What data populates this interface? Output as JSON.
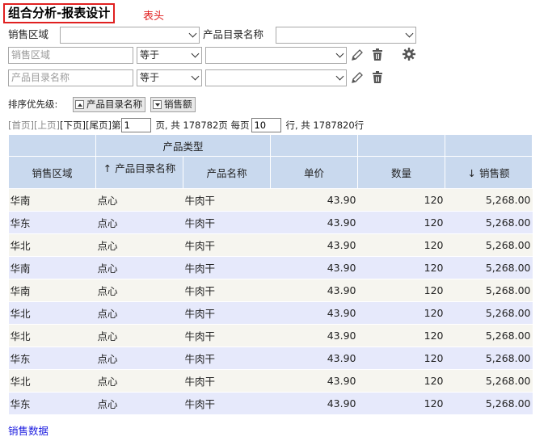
{
  "header": {
    "title": "组合分析-报表设计",
    "note": "表头"
  },
  "filters": {
    "region_label": "销售区域",
    "region_value": "",
    "category_label": "产品目录名称",
    "category_value": "",
    "rows": [
      {
        "field_placeholder": "销售区域",
        "operator": "等于",
        "value": ""
      },
      {
        "field_placeholder": "产品目录名称",
        "operator": "等于",
        "value": ""
      }
    ]
  },
  "sort": {
    "label": "排序优先级:",
    "buttons": [
      {
        "label": "产品目录名称",
        "direction": "asc"
      },
      {
        "label": "销售额",
        "direction": "desc"
      }
    ]
  },
  "pager": {
    "first": "[首页]",
    "prev": "[上页]",
    "next": "[下页]",
    "last": "[尾页]",
    "page_prefix": "第",
    "page_value": "1",
    "page_suffix": "页, 共 178782页 每页",
    "per_page_value": "10",
    "rows_suffix": "行, 共 1787820行"
  },
  "table": {
    "group_header": "产品类型",
    "columns": {
      "region": "销售区域",
      "category": "产品目录名称",
      "category_sort": "↑",
      "product": "产品名称",
      "price": "单价",
      "qty": "数量",
      "sales": "销售额",
      "sales_sort": "↓"
    },
    "rows": [
      {
        "region": "华南",
        "category": "点心",
        "product": "牛肉干",
        "price": "43.90",
        "qty": "120",
        "sales": "5,268.00"
      },
      {
        "region": "华东",
        "category": "点心",
        "product": "牛肉干",
        "price": "43.90",
        "qty": "120",
        "sales": "5,268.00"
      },
      {
        "region": "华北",
        "category": "点心",
        "product": "牛肉干",
        "price": "43.90",
        "qty": "120",
        "sales": "5,268.00"
      },
      {
        "region": "华南",
        "category": "点心",
        "product": "牛肉干",
        "price": "43.90",
        "qty": "120",
        "sales": "5,268.00"
      },
      {
        "region": "华南",
        "category": "点心",
        "product": "牛肉干",
        "price": "43.90",
        "qty": "120",
        "sales": "5,268.00"
      },
      {
        "region": "华北",
        "category": "点心",
        "product": "牛肉干",
        "price": "43.90",
        "qty": "120",
        "sales": "5,268.00"
      },
      {
        "region": "华北",
        "category": "点心",
        "product": "牛肉干",
        "price": "43.90",
        "qty": "120",
        "sales": "5,268.00"
      },
      {
        "region": "华东",
        "category": "点心",
        "product": "牛肉干",
        "price": "43.90",
        "qty": "120",
        "sales": "5,268.00"
      },
      {
        "region": "华北",
        "category": "点心",
        "product": "牛肉干",
        "price": "43.90",
        "qty": "120",
        "sales": "5,268.00"
      },
      {
        "region": "华东",
        "category": "点心",
        "product": "牛肉干",
        "price": "43.90",
        "qty": "120",
        "sales": "5,268.00"
      }
    ]
  },
  "footer": {
    "link": "销售数据"
  },
  "icons": {
    "edit": "pencil-icon",
    "delete": "trash-icon",
    "settings": "gear-icon"
  },
  "colors": {
    "accent_red": "#e02020",
    "header_bg": "#c9d9ee",
    "row_odd": "#f6f5ef",
    "row_even": "#e6e9fb",
    "link": "#1a1adf"
  }
}
